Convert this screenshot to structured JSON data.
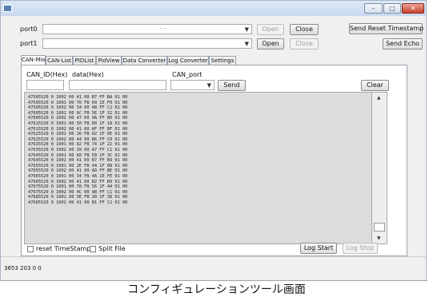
{
  "window": {
    "minimize_glyph": "–",
    "maximize_glyph": "□",
    "close_glyph": "✕"
  },
  "ports": [
    {
      "label": "port0",
      "value": "·  ·",
      "open_label": "Open",
      "close_label": "Close",
      "open_enabled": false,
      "close_enabled": true
    },
    {
      "label": "port1",
      "value": "",
      "open_label": "Open",
      "close_label": "Close",
      "open_enabled": true,
      "close_enabled": false
    }
  ],
  "buttons": {
    "send_reset_timestamp": "Send Reset Timestamp",
    "send_echo": "Send Echo",
    "send": "Send",
    "clear": "Clear",
    "log_start": "Log Start",
    "log_stop": "Log Stop"
  },
  "tabs": [
    {
      "label": "CAN-Mise",
      "active": true
    },
    {
      "label": "CAN-List",
      "active": false
    },
    {
      "label": "PIDList",
      "active": false
    },
    {
      "label": "PidView",
      "active": false
    },
    {
      "label": "Data Converter",
      "active": false
    },
    {
      "label": "Log Converter",
      "active": false
    },
    {
      "label": "Settings",
      "active": false
    }
  ],
  "fields": {
    "can_id_label": "CAN_ID(Hex)",
    "data_label": "data(Hex)",
    "can_port_label": "CAN_port",
    "can_id_value": "",
    "data_value": "",
    "can_port_value": ""
  },
  "log_lines": [
    "47585520 0 1002 00 41 00 B7 FF BA 01 00",
    "47595520 0 1001 00 76 FB 60 1E F0 01 00",
    "47595520 0 1002 00 34 00 AB FF C2 01 00",
    "47605520 0 1001 00 6C FB 5E 1F 32 01 00",
    "47605520 0 1002 00 47 00 9A FF B0 01 00",
    "47615520 0 1001 00 50 FB 80 1F 18 01 00",
    "47615520 0 1002 00 41 00 AF FF BF 01 00",
    "47625520 0 1001 00 26 FB 82 1F 6E 01 00",
    "47625520 0 1002 00 44 00 B6 FF C0 01 00",
    "47635520 0 1001 00 82 FB 74 1F 22 01 00",
    "47635520 0 1002 00 39 00 A7 FF C1 01 00",
    "47645520 0 1001 00 60 FB 50 1F 3C 01 00",
    "47645520 0 1002 00 41 00 B7 FF B9 01 00",
    "47655520 0 1001 00 2E FB 44 1F 08 01 00",
    "47655520 0 1002 00 41 00 AD FF BE 01 00",
    "47665520 0 1001 00 34 FB 4A 1E FE 01 00",
    "47665520 0 1002 00 41 00 B2 FF B9 01 00",
    "47675520 0 1001 00 78 FB 56 1F 44 01 00",
    "47675520 0 1002 00 4C 00 AB FF C1 01 00",
    "47685520 0 1001 00 5E FB 30 1F 38 01 00",
    "47685520 0 1002 00 41 00 B1 FF C2 01 00"
  ],
  "options": {
    "reset_timestamp_label": "reset TimeStamp",
    "reset_timestamp_checked": false,
    "split_file_label": "Split File",
    "split_file_checked": false
  },
  "status": {
    "text": "3653 203 0 0"
  },
  "caption": "コンフィギュレーションツール画面"
}
